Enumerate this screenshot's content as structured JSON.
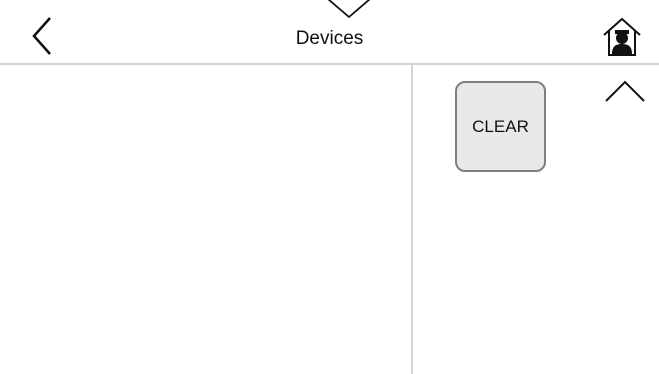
{
  "header": {
    "title": "Devices",
    "back_icon": "chevron-left-icon",
    "pull_icon": "chevron-down-icon",
    "home_icon": "home-user-icon"
  },
  "right_panel": {
    "clear_label": "CLEAR",
    "scroll_icon": "chevron-up-icon"
  },
  "colors": {
    "divider": "#d4d4d4",
    "button_fill": "#e9e9e9",
    "button_border": "#7f7f7f"
  }
}
